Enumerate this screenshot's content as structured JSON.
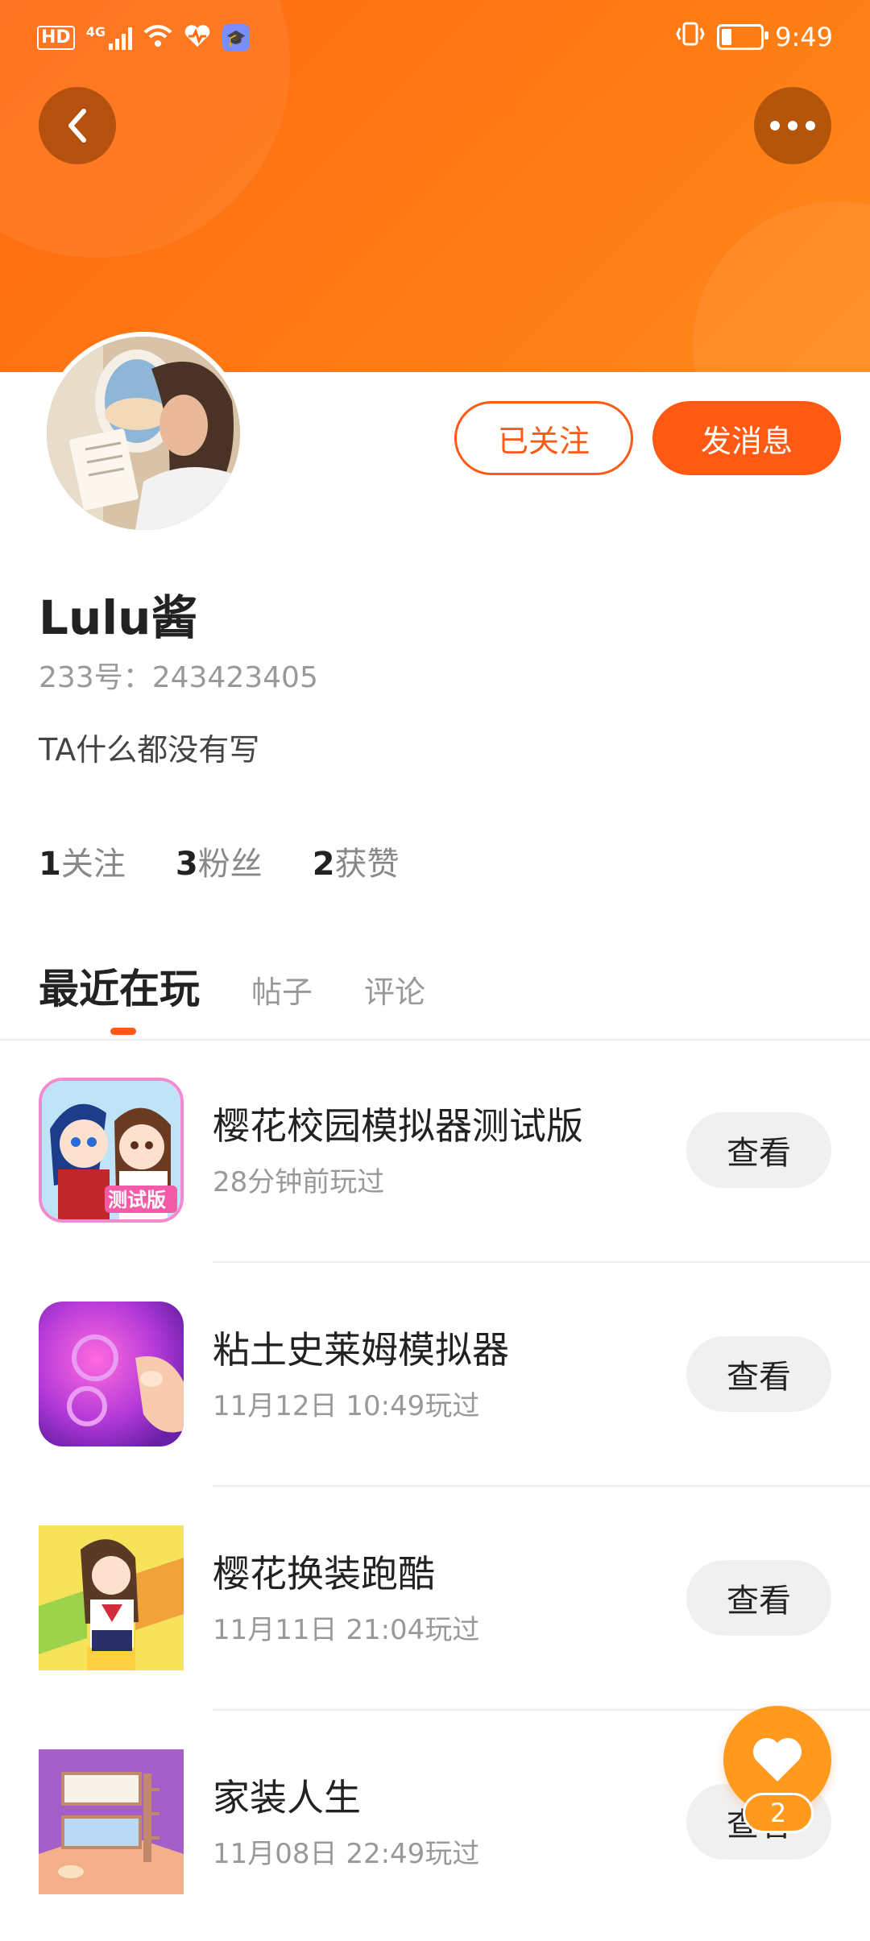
{
  "status_bar": {
    "time": "9:49",
    "hd": "HD",
    "network": "4G"
  },
  "header": {
    "back_icon": "chevron-left-icon",
    "more_icon": "more-horizontal-icon"
  },
  "profile": {
    "name": "Lulu酱",
    "id_text": "233号：243423405",
    "bio": "TA什么都没有写",
    "follow_button": "已关注",
    "message_button": "发消息",
    "stats": [
      {
        "count": "1",
        "label": "关注"
      },
      {
        "count": "3",
        "label": "粉丝"
      },
      {
        "count": "2",
        "label": "获赞"
      }
    ]
  },
  "tabs": [
    {
      "label": "最近在玩",
      "active": true
    },
    {
      "label": "帖子",
      "active": false
    },
    {
      "label": "评论",
      "active": false
    }
  ],
  "games": [
    {
      "title": "樱花校园模拟器测试版",
      "time": "28分钟前玩过",
      "button": "查看",
      "icon_badge": "测试版"
    },
    {
      "title": "粘土史莱姆模拟器",
      "time": "11月12日 10:49玩过",
      "button": "查看"
    },
    {
      "title": "樱花换装跑酷",
      "time": "11月11日 21:04玩过",
      "button": "查看"
    },
    {
      "title": "家装人生",
      "time": "11月08日 22:49玩过",
      "button": "查看"
    }
  ],
  "fab": {
    "icon": "heart-icon",
    "count": "2"
  },
  "colors": {
    "brand": "#ff5a14",
    "banner": "#ff7a14",
    "fab": "#ff9a1f"
  }
}
